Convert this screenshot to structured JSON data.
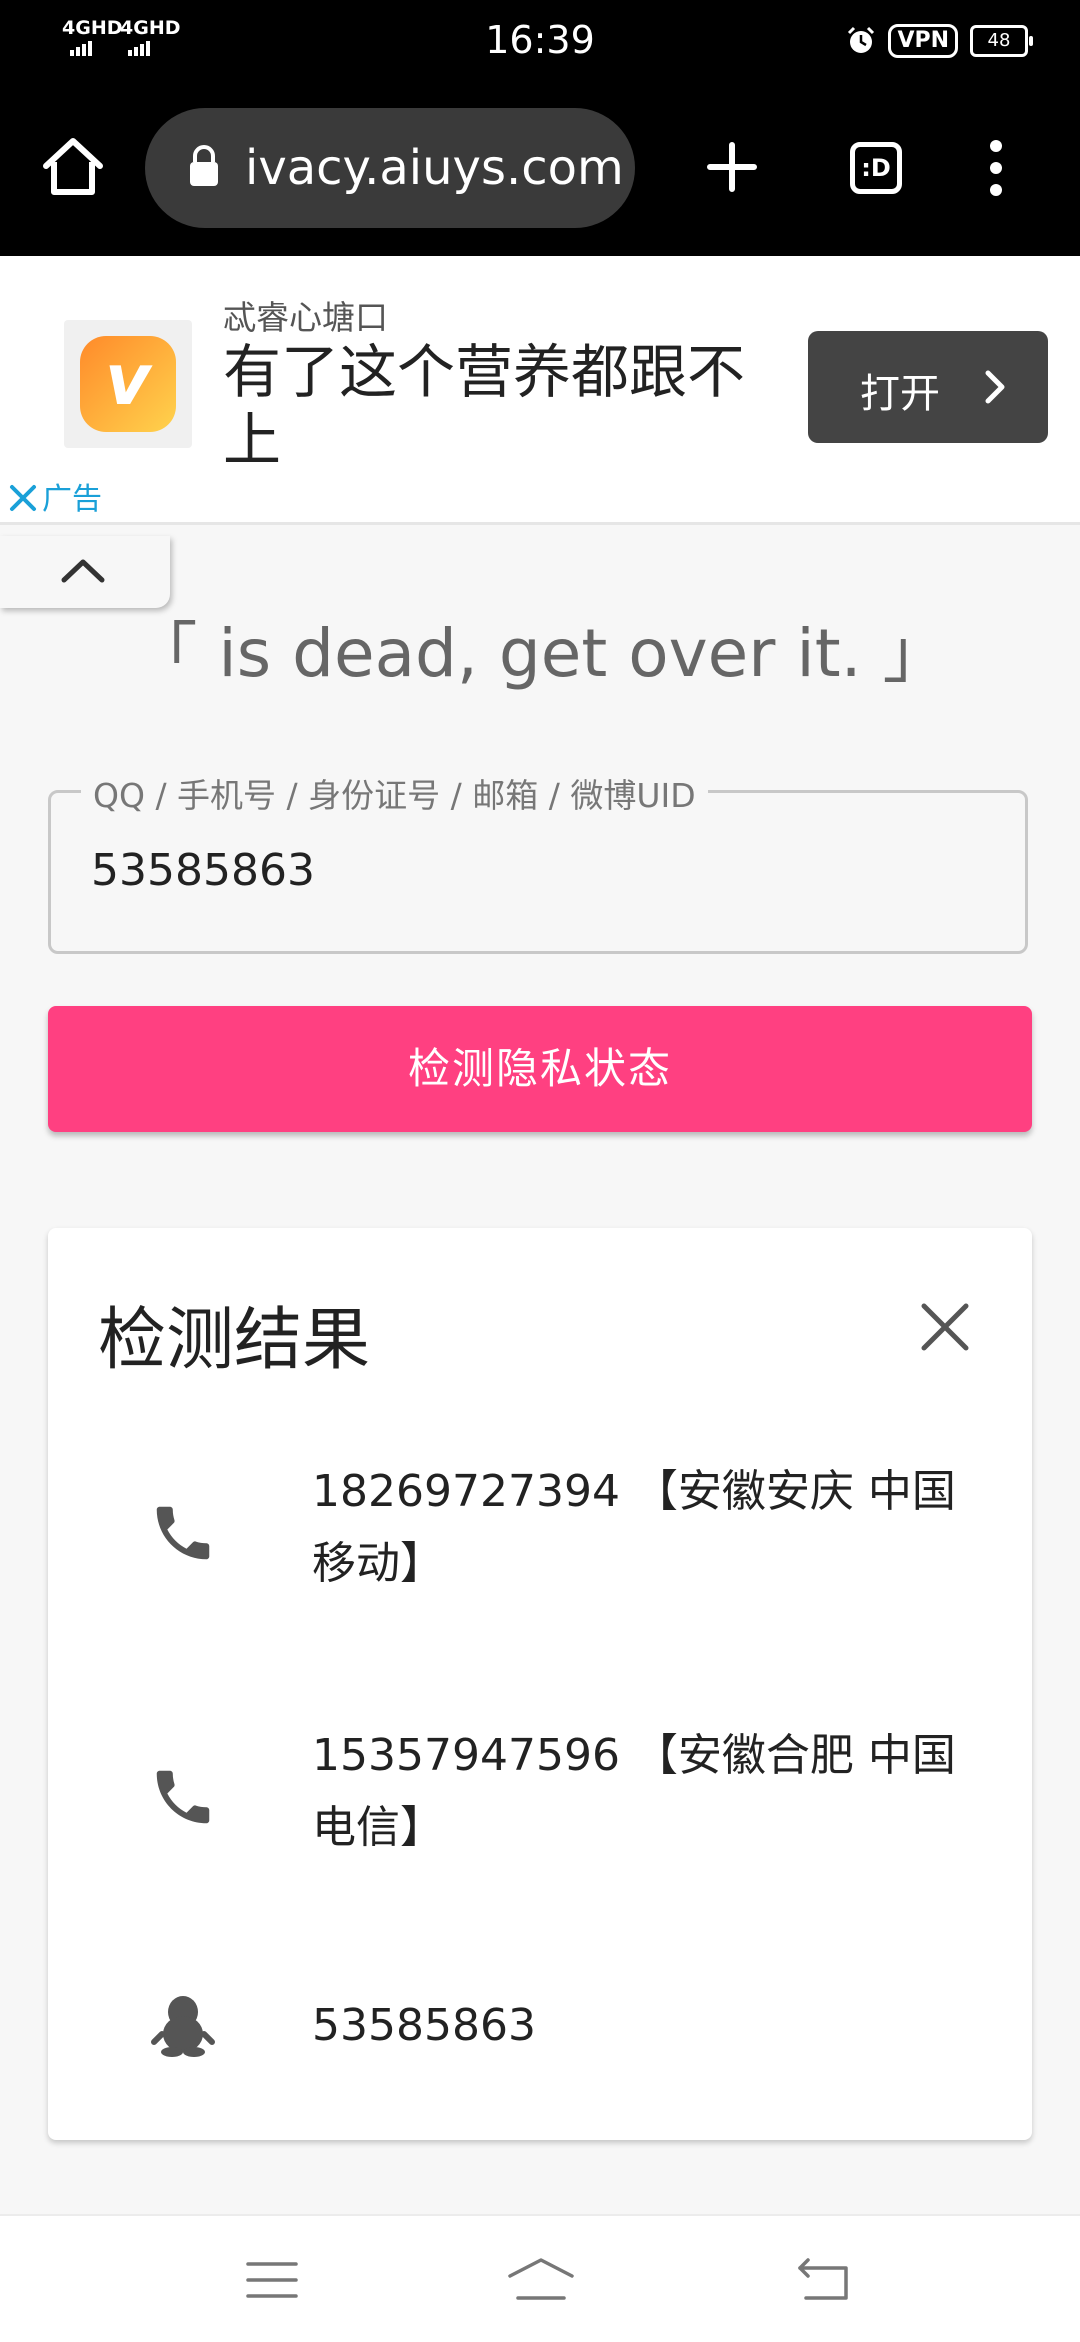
{
  "status_bar": {
    "signal_1": "4GHD",
    "signal_2": "4GHD",
    "time": "16:39",
    "vpn": "VPN",
    "battery": "48"
  },
  "browser": {
    "url": "ivacy.aiuys.com",
    "tab_switcher": ":D"
  },
  "ad": {
    "source": "忒睿心塘口",
    "title": "有了这个营养都跟不上",
    "open_label": "打开",
    "ad_label": "广告",
    "app_letter": "v"
  },
  "slogan": "「 is dead, get over it. 」",
  "search": {
    "label": "QQ / 手机号 / 身份证号 / 邮箱 / 微博UID",
    "value": "53585863",
    "button": "检测隐私状态"
  },
  "results": {
    "title": "检测结果",
    "items": [
      {
        "icon": "phone-icon",
        "text": "18269727394 【安徽安庆 中国移动】"
      },
      {
        "icon": "phone-icon",
        "text": "15357947596 【安徽合肥 中国电信】"
      },
      {
        "icon": "qq-penguin-icon",
        "text": "53585863"
      }
    ]
  },
  "colors": {
    "accent": "#ff4081",
    "ad_link": "#1aa0d8"
  }
}
